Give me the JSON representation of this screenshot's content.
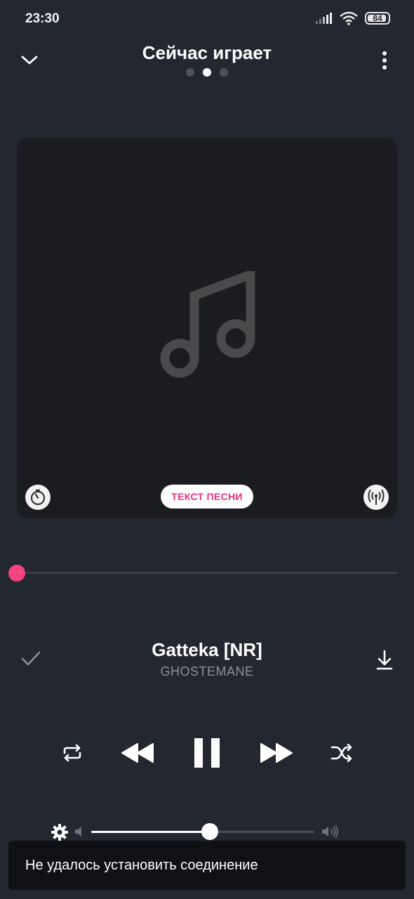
{
  "status_bar": {
    "time": "23:30",
    "battery": "84",
    "icons": [
      "signal-icon",
      "wifi-icon",
      "battery-icon"
    ]
  },
  "header": {
    "title": "Сейчас играет",
    "pages": 3,
    "active_page": 2
  },
  "artwork": {
    "placeholder_icon": "music-note-icon",
    "lyrics_label": "ТЕКСТ ПЕСНИ"
  },
  "progress": {
    "fraction": 0.0
  },
  "track": {
    "title": "Gatteka [NR]",
    "artist": "GHOSTEMANE"
  },
  "controls": [
    "repeat-icon",
    "rewind-icon",
    "pause-icon",
    "fast-forward-icon",
    "shuffle-icon"
  ],
  "volume": {
    "fraction": 0.53
  },
  "snackbar": {
    "message": "Не удалось установить соединение"
  },
  "colors": {
    "background": "#232730",
    "artwork_bg": "#1b1c1f",
    "accent": "#f2457f",
    "lyrics_text": "#e8357a",
    "artist_text": "#8c9099"
  }
}
